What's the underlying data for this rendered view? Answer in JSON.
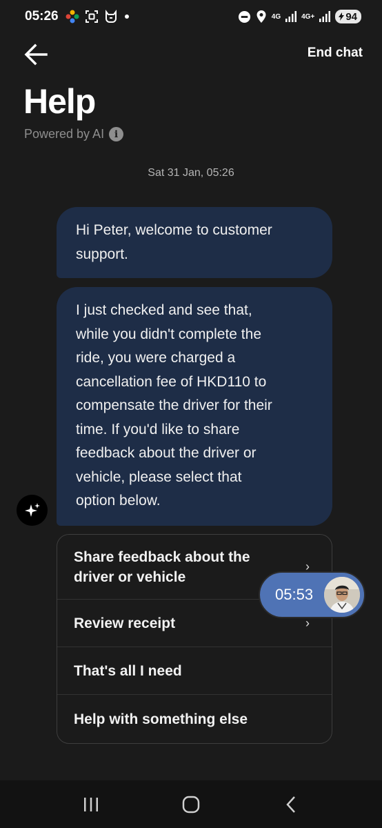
{
  "status_bar": {
    "time": "05:26",
    "network_1": "4G",
    "network_2": "4G+",
    "battery": "94"
  },
  "header": {
    "end_chat_label": "End chat",
    "title": "Help",
    "powered_by": "Powered by AI",
    "info_glyph": "i"
  },
  "chat": {
    "timestamp": "Sat 31 Jan, 05:26",
    "messages": [
      {
        "lines": [
          "Hi Peter, welcome to customer",
          "support."
        ]
      },
      {
        "lines": [
          "I just checked and see that,",
          "while you didn't complete the",
          "ride, you were charged a",
          "cancellation fee of HKD110 to",
          "compensate the driver for their",
          "time. If you'd like to share",
          "feedback about the driver or",
          "vehicle, please select that",
          "option below."
        ]
      }
    ]
  },
  "options": [
    {
      "lines": [
        "Share feedback about the",
        "driver or vehicle"
      ],
      "chevron": "›"
    },
    {
      "lines": [
        "Review receipt"
      ],
      "chevron": "›"
    },
    {
      "lines": [
        "That's all I need"
      ],
      "chevron": ""
    },
    {
      "lines": [
        "Help with something else"
      ],
      "chevron": ""
    }
  ],
  "call_overlay": {
    "time": "05:53"
  },
  "icons": {
    "back": "arrow-left-icon",
    "info": "info-icon",
    "bot": "sparkle-icon",
    "nav_recents": "recents-icon",
    "nav_home": "home-icon",
    "nav_back": "back-chevron-icon"
  },
  "colors": {
    "background": "#1b1b1b",
    "bubble": "#1e2d47",
    "call_pill": "#4f73b5",
    "muted_text": "#8e8e8e"
  }
}
